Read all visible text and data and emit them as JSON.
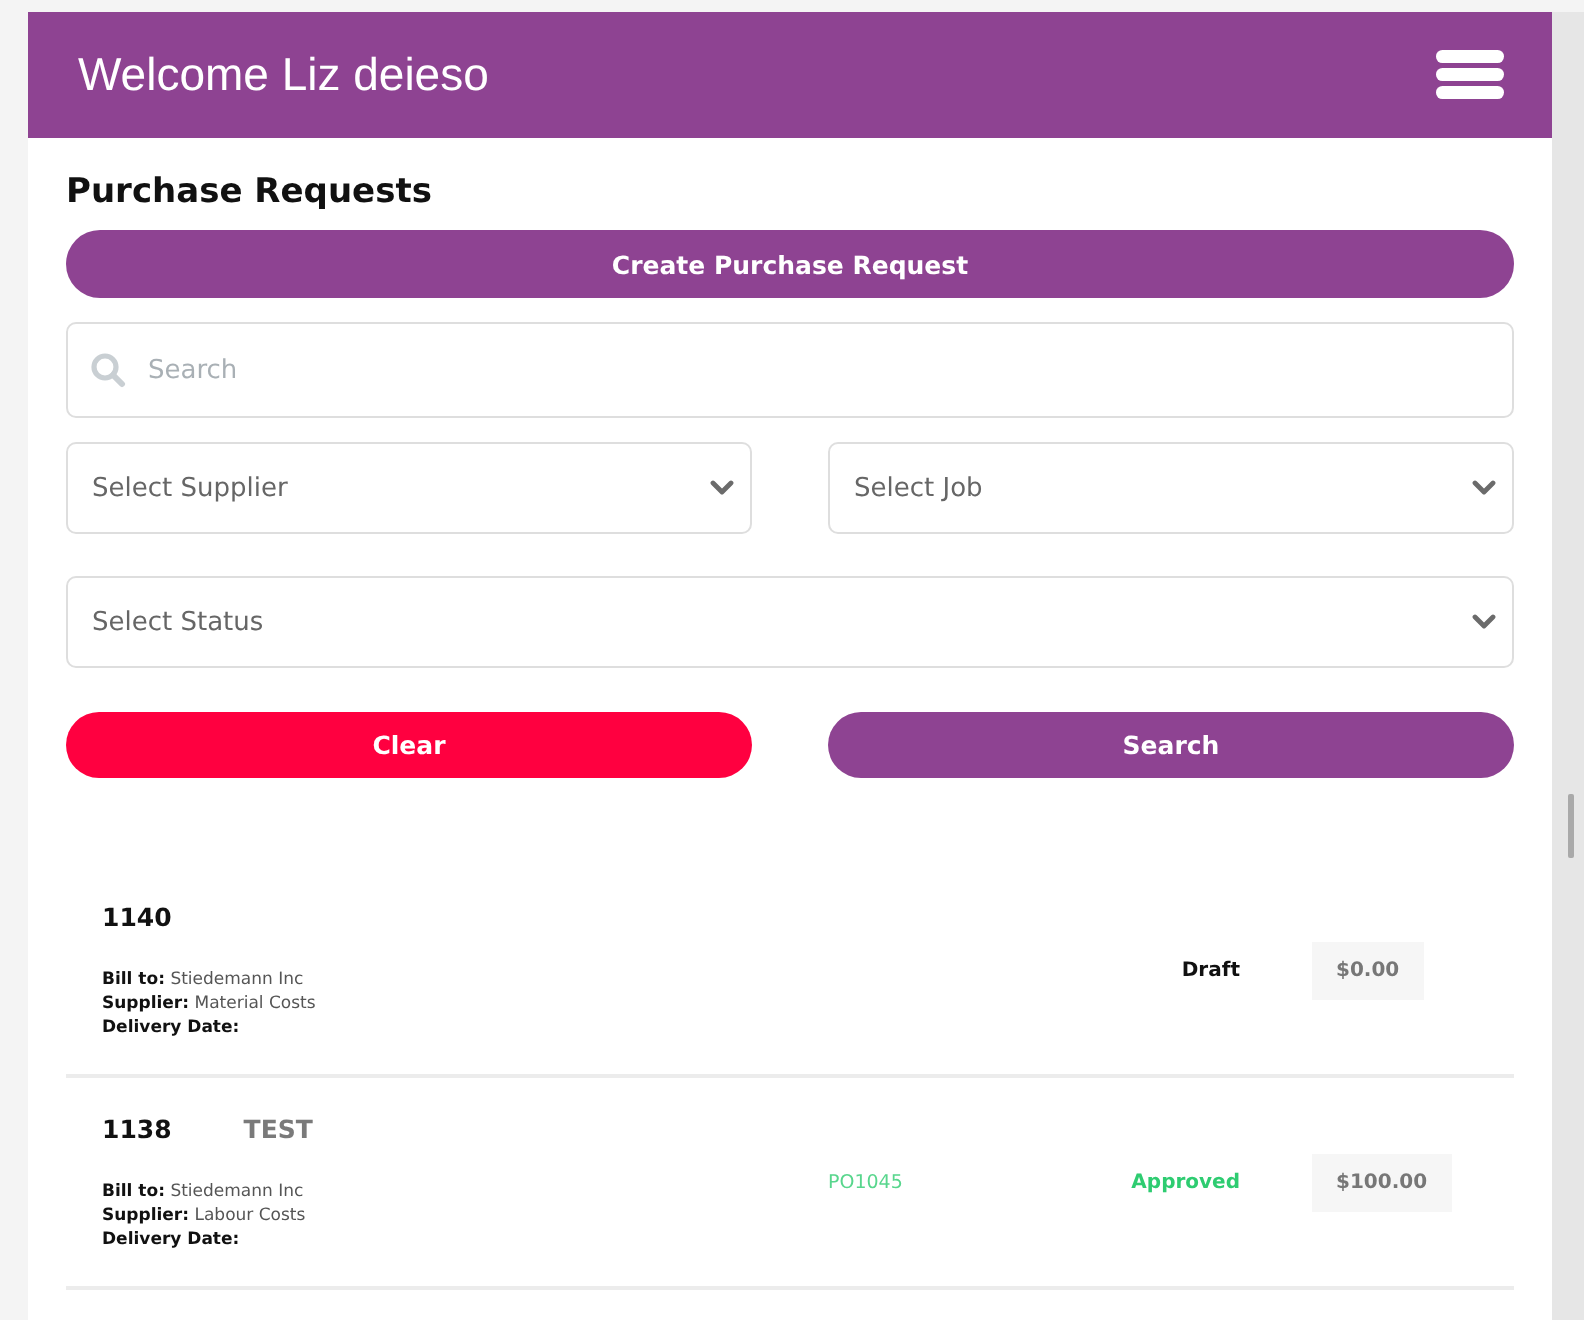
{
  "header": {
    "title": "Welcome Liz deieso"
  },
  "page_title": "Purchase Requests",
  "create_button": "Create Purchase Request",
  "search": {
    "placeholder": "Search"
  },
  "filters": [
    {
      "placeholder": "Select Supplier"
    },
    {
      "placeholder": "Select Job"
    },
    {
      "placeholder": "Select Status"
    }
  ],
  "buttons": [
    {
      "label": "Clear",
      "kind": "clear"
    },
    {
      "label": "Search",
      "kind": "search"
    }
  ],
  "requests": [
    {
      "number": "1140",
      "bill_to_label": "Bill to:",
      "bill_to": "Stiedemann Inc",
      "supplier_label": "Supplier:",
      "supplier": "Material Costs",
      "delivery_label": "Delivery Date:",
      "status": "Draft",
      "kind": "draft",
      "amount": "$0.00"
    },
    {
      "number": "1138",
      "tag": "TEST",
      "bill_to_label": "Bill to:",
      "bill_to": "Stiedemann Inc",
      "supplier_label": "Supplier:",
      "supplier": "Labour Costs",
      "delivery_label": "Delivery Date:",
      "po": "PO1045",
      "status": "Approved",
      "kind": "approved",
      "amount": "$100.00"
    }
  ]
}
